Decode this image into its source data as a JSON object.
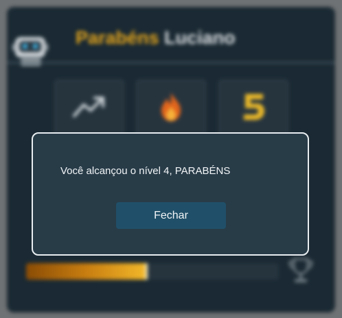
{
  "header": {
    "congrats_word": "Parabéns",
    "user_name": "Luciano"
  },
  "stats": [
    {
      "icon": "trending-up-icon",
      "caption": ""
    },
    {
      "icon": "fire-icon",
      "caption": ""
    },
    {
      "icon": "number-five-icon",
      "caption": ""
    }
  ],
  "progress": {
    "label": "",
    "fraction": 0.48
  },
  "modal": {
    "message": "Você alcançou o nível 4, PARABÉNS",
    "close_label": "Fechar"
  },
  "colors": {
    "accent": "#e3a51c",
    "card_bg": "#1a2933",
    "modal_bg": "#283c48",
    "button_bg": "#205069"
  }
}
